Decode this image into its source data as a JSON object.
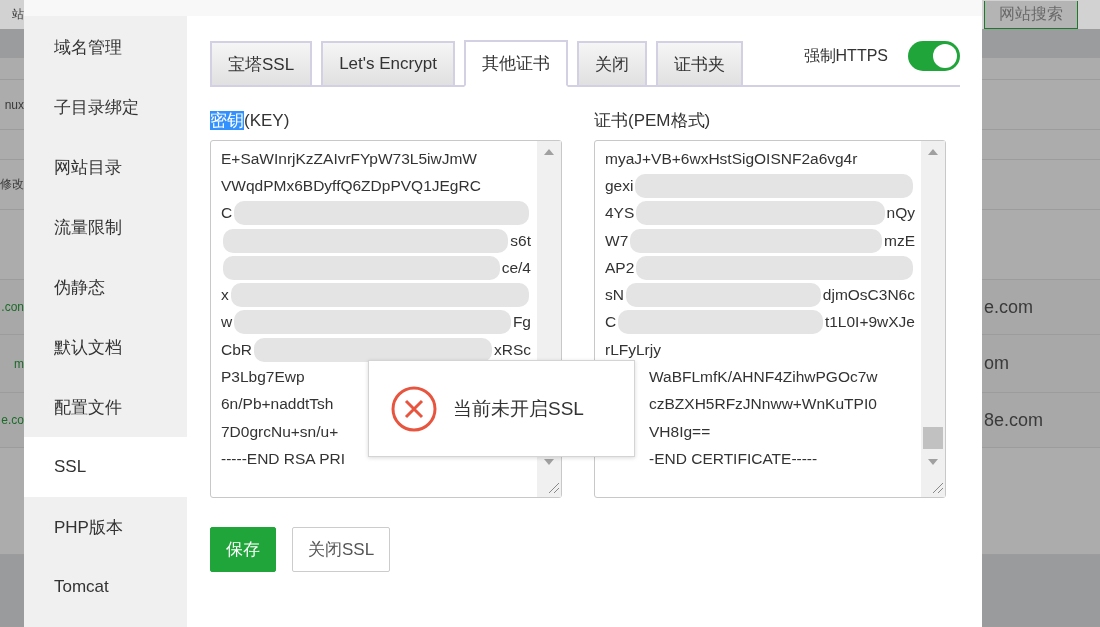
{
  "background_page": {
    "rows": [
      {
        "left": "站",
        "button": "网站搜索"
      },
      {},
      {},
      {
        "left": "nux"
      },
      {},
      {
        "left": "修改"
      },
      {},
      {
        "left": ".con",
        "link": true,
        "right": "e.com"
      },
      {
        "left": "m",
        "link": true,
        "right": "om"
      },
      {
        "left": "e.co",
        "link": true,
        "right": "8e.com"
      },
      {},
      {}
    ]
  },
  "sidebar": {
    "items": [
      {
        "label": "域名管理",
        "selected": false
      },
      {
        "label": "子目录绑定",
        "selected": false
      },
      {
        "label": "网站目录",
        "selected": false
      },
      {
        "label": "流量限制",
        "selected": false
      },
      {
        "label": "伪静态",
        "selected": false
      },
      {
        "label": "默认文档",
        "selected": false
      },
      {
        "label": "配置文件",
        "selected": false
      },
      {
        "label": "SSL",
        "selected": true
      },
      {
        "label": "PHP版本",
        "selected": false
      },
      {
        "label": "Tomcat",
        "selected": false
      }
    ]
  },
  "tabs": [
    {
      "label": "宝塔SSL",
      "selected": false
    },
    {
      "label": "Let's Encrypt",
      "selected": false
    },
    {
      "label": "其他证书",
      "selected": true
    },
    {
      "label": "关闭",
      "selected": false
    },
    {
      "label": "证书夹",
      "selected": false
    }
  ],
  "force_https": {
    "label": "强制HTTPS",
    "on": true
  },
  "fields": [
    {
      "label_highlighted": "密钥",
      "label_rest": "(KEY)",
      "lines": [
        {
          "left": "E+SaWInrjKzZAIvrFYpW73L5iwJmW"
        },
        {
          "left": "VWqdPMx6BDyffQ6ZDpPVQ1JEgRC"
        },
        {
          "left": "C",
          "redacted": true
        },
        {
          "right": "s6t",
          "redacted": true
        },
        {
          "right": "ce/4",
          "redacted": true
        },
        {
          "left": "x",
          "redacted": true
        },
        {
          "left": "w",
          "right": "Fg",
          "redacted": true
        },
        {
          "left": "CbR",
          "right": "xRSc",
          "redacted": true
        },
        {
          "left": "P3Lbg7Ewp"
        },
        {
          "left": "6n/Pb+naddtTsh"
        },
        {
          "left": "7D0grcNu+sn/u+"
        },
        {
          "left": "-----END RSA PRI"
        }
      ]
    },
    {
      "label_rest": "证书(PEM格式)",
      "lines": [
        {
          "left": "myaJ+VB+6wxHstSigOISNF2a6vg4r"
        },
        {
          "left": "gexi",
          "redacted": true
        },
        {
          "left": "4YS",
          "right": "nQy",
          "redacted": true
        },
        {
          "left": "W7",
          "right": "mzE",
          "redacted": true
        },
        {
          "left": "AP2",
          "redacted": true
        },
        {
          "left": "sN",
          "right": "djmOsC3N6c",
          "redacted": true
        },
        {
          "left": "C",
          "right": "t1L0I+9wXJe",
          "redacted": true
        },
        {
          "left": "rLFyLrjy"
        },
        {
          "left": "WaBFLmfK/AHNF4ZihwPGOc7w",
          "covered": true
        },
        {
          "left": "czBZXH5RFzJNnww+WnKuTPI0",
          "covered": true
        },
        {
          "left": "VH8Ig==",
          "covered": true
        },
        {
          "left": "-END CERTIFICATE-----",
          "covered": true
        }
      ]
    }
  ],
  "buttons": [
    {
      "label": "保存",
      "kind": "primary"
    },
    {
      "label": "关闭SSL",
      "kind": "default"
    }
  ],
  "toast": {
    "kind": "error",
    "message": "当前未开启SSL"
  }
}
